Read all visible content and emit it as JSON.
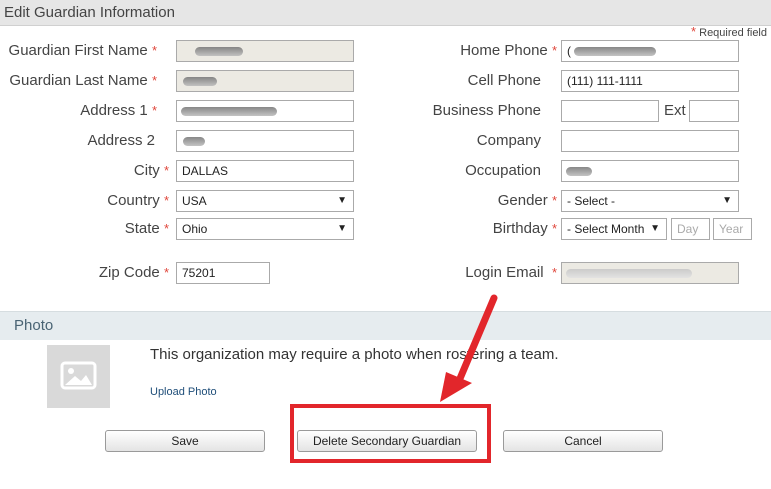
{
  "header": {
    "title": "Edit Guardian Information"
  },
  "required_note": {
    "star": "*",
    "text": " Required field"
  },
  "required_star": "*",
  "left_form": {
    "first_name": {
      "label": "Guardian First Name",
      "value": ""
    },
    "last_name": {
      "label": "Guardian Last Name",
      "value": ""
    },
    "address1": {
      "label": "Address 1",
      "value": ""
    },
    "address2": {
      "label": "Address 2",
      "value": ""
    },
    "city": {
      "label": "City",
      "value": "DALLAS"
    },
    "country": {
      "label": "Country",
      "value": "USA"
    },
    "state": {
      "label": "State",
      "value": "Ohio"
    },
    "zip": {
      "label": "Zip Code",
      "value": "75201"
    }
  },
  "right_form": {
    "home_phone": {
      "label": "Home Phone",
      "value": "("
    },
    "cell_phone": {
      "label": "Cell Phone",
      "value": "(111) 111-1111"
    },
    "business_phone": {
      "label": "Business Phone",
      "value": ""
    },
    "ext": {
      "label": "Ext",
      "value": ""
    },
    "company": {
      "label": "Company",
      "value": ""
    },
    "occupation": {
      "label": "Occupation",
      "value": ""
    },
    "gender": {
      "label": "Gender",
      "value": "- Select -"
    },
    "birthday": {
      "label": "Birthday",
      "month": "- Select Month",
      "day_placeholder": "Day",
      "year_placeholder": "Year"
    },
    "login_email": {
      "label": "Login Email",
      "value": ""
    }
  },
  "photo": {
    "title": "Photo",
    "message": "This organization may require a photo when rostering a team.",
    "upload_label": "Upload Photo",
    "placeholder_icon": "image-placeholder-icon"
  },
  "buttons": {
    "save": "Save",
    "delete_secondary": "Delete Secondary Guardian",
    "cancel": "Cancel"
  },
  "colors": {
    "required": "#e0463b",
    "annotation": "#e2262b",
    "link": "#1f4e79"
  }
}
